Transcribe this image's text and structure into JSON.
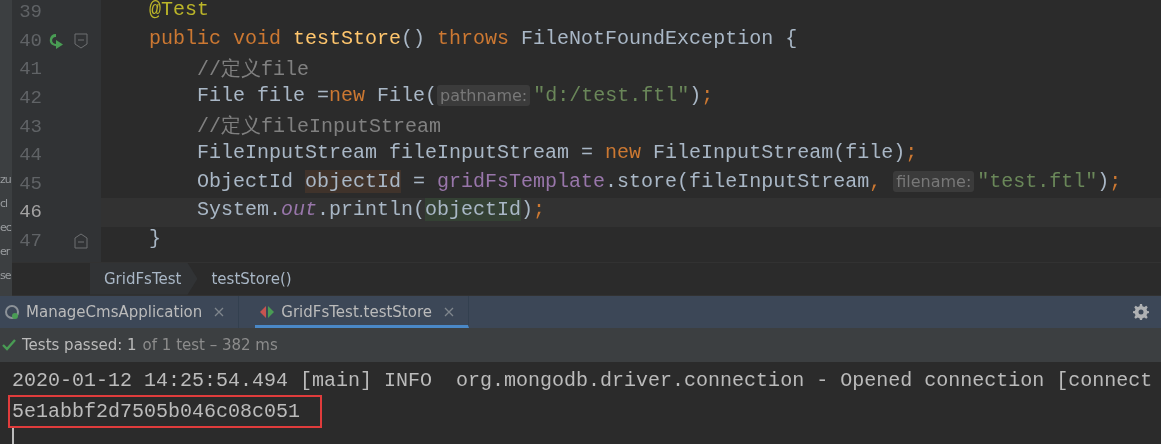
{
  "side_panel_fragments": [
    "zu",
    "cl",
    "ec",
    "er",
    "se"
  ],
  "editor": {
    "lines": [
      {
        "number": "39",
        "current": false,
        "kind": "plain",
        "tokens": [
          {
            "kind": "annotation",
            "text": "    @Test"
          }
        ]
      },
      {
        "number": "40",
        "current": false,
        "kind": "run-fold",
        "tokens": [
          {
            "kind": "keyword",
            "text": "    public void "
          },
          {
            "kind": "method",
            "text": "testStore"
          },
          {
            "kind": "plain",
            "text": "() "
          },
          {
            "kind": "keyword",
            "text": "throws "
          },
          {
            "kind": "plain",
            "text": "FileNotFoundException {"
          }
        ]
      },
      {
        "number": "41",
        "current": false,
        "kind": "plain",
        "tokens": [
          {
            "kind": "comment",
            "text": "        //定义file"
          }
        ]
      },
      {
        "number": "42",
        "current": false,
        "kind": "plain",
        "tokens": [
          {
            "kind": "plain",
            "text": "        File file ="
          },
          {
            "kind": "keyword",
            "text": "new "
          },
          {
            "kind": "plain",
            "text": "File("
          },
          {
            "kind": "hint",
            "text": "pathname:"
          },
          {
            "kind": "string",
            "text": "\"d:/test.ftl\""
          },
          {
            "kind": "plain",
            "text": ")"
          },
          {
            "kind": "keyword",
            "text": ";"
          }
        ]
      },
      {
        "number": "43",
        "current": false,
        "kind": "plain",
        "tokens": [
          {
            "kind": "comment",
            "text": "        //定义fileInputStream"
          }
        ]
      },
      {
        "number": "44",
        "current": false,
        "kind": "plain",
        "tokens": [
          {
            "kind": "plain",
            "text": "        FileInputStream fileInputStream = "
          },
          {
            "kind": "keyword",
            "text": "new "
          },
          {
            "kind": "plain",
            "text": "FileInputStream(file)"
          },
          {
            "kind": "keyword",
            "text": ";"
          }
        ]
      },
      {
        "number": "45",
        "current": false,
        "kind": "plain",
        "tokens": [
          {
            "kind": "plain",
            "text": "        ObjectId "
          },
          {
            "kind": "declared",
            "text": "objectId"
          },
          {
            "kind": "plain",
            "text": " = "
          },
          {
            "kind": "field",
            "text": "gridFsTemplate"
          },
          {
            "kind": "plain",
            "text": ".store(fileInputStream"
          },
          {
            "kind": "keyword",
            "text": ", "
          },
          {
            "kind": "hint",
            "text": "filename:"
          },
          {
            "kind": "string",
            "text": "\"test.ftl\""
          },
          {
            "kind": "plain",
            "text": ")"
          },
          {
            "kind": "keyword",
            "text": ";"
          }
        ]
      },
      {
        "number": "46",
        "current": true,
        "kind": "plain",
        "tokens": [
          {
            "kind": "plain",
            "text": "        System."
          },
          {
            "kind": "static",
            "text": "out"
          },
          {
            "kind": "plain",
            "text": ".println("
          },
          {
            "kind": "usage",
            "text": "objectId"
          },
          {
            "kind": "plain",
            "text": ")"
          },
          {
            "kind": "keyword",
            "text": ";"
          }
        ]
      },
      {
        "number": "47",
        "current": false,
        "kind": "fold-end",
        "tokens": [
          {
            "kind": "plain",
            "text": "    }"
          }
        ]
      }
    ]
  },
  "breadcrumbs": [
    "GridFsTest",
    "testStore()"
  ],
  "run_tabs": [
    {
      "label": "ManageCmsApplication",
      "kind": "app",
      "selected": false
    },
    {
      "label": "GridFsTest.testStore",
      "kind": "test",
      "selected": true
    }
  ],
  "test_status": {
    "summary": "Tests passed: 1",
    "detail": "of 1 test – 382 ms"
  },
  "console": {
    "lines": [
      {
        "text": "2020-01-12 14:25:54.494 [main] INFO  org.mongodb.driver.connection - Opened connection [connect",
        "highlighted": false
      },
      {
        "text": "5e1abbf2d7505b046c08c051",
        "highlighted": true
      }
    ]
  }
}
